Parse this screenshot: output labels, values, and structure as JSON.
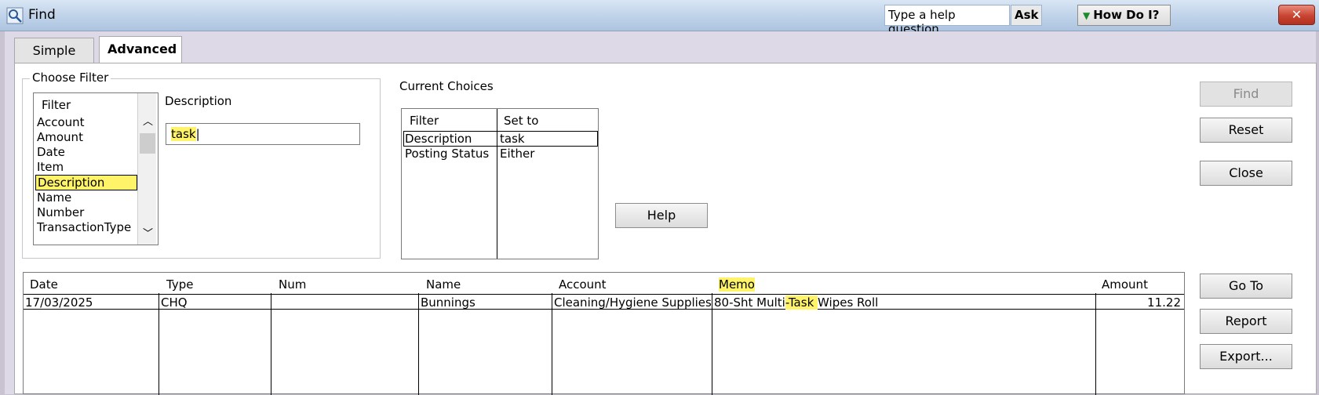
{
  "window": {
    "title": "Find",
    "help_placeholder": "Type a help question",
    "ask_label": "Ask",
    "how_do_i_label": "How Do I?",
    "close_label": "✕"
  },
  "tabs": [
    {
      "label": "Simple",
      "active": false
    },
    {
      "label": "Advanced",
      "active": true
    }
  ],
  "choose_filter": {
    "legend": "Choose Filter",
    "list_header": "Filter",
    "items": [
      "Account",
      "Amount",
      "Date",
      "Item",
      "Description",
      "Name",
      "Number",
      "TransactionType"
    ],
    "selected": "Description",
    "field_label": "Description",
    "field_value": "task"
  },
  "current_choices": {
    "label": "Current Choices",
    "col_filter": "Filter",
    "col_set_to": "Set to",
    "rows": [
      {
        "filter": "Description",
        "set_to": "task"
      },
      {
        "filter": "Posting Status",
        "set_to": "Either"
      }
    ]
  },
  "buttons": {
    "find": "Find",
    "reset": "Reset",
    "close": "Close",
    "help": "Help",
    "go_to": "Go To",
    "report": "Report",
    "export": "Export..."
  },
  "results": {
    "columns": [
      "Date",
      "Type",
      "Num",
      "Name",
      "Account",
      "Memo",
      "Amount"
    ],
    "rows": [
      {
        "date": "17/03/2025",
        "type": "CHQ",
        "num": "",
        "name": "Bunnings",
        "account": "Cleaning/Hygiene Supplies",
        "memo_pre": "80-Sht Multi",
        "memo_hl": "-Task ",
        "memo_post": "Wipes Roll",
        "amount": "11.22"
      }
    ]
  },
  "colors": {
    "highlight": "#fff36a",
    "title_gradient_top": "#d9e6f4",
    "close_red": "#c94432"
  }
}
